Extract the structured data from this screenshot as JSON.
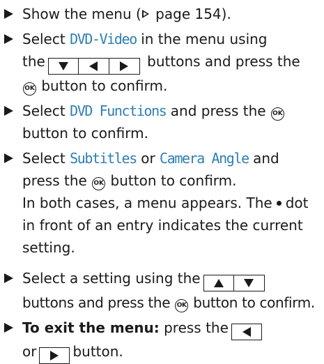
{
  "steps": [
    {
      "a": "Show the menu (",
      "ref": "page 154",
      "b": ")."
    },
    {
      "a": "Select ",
      "hl": "DVD-Video",
      "b": " in the menu using",
      "c": "the",
      "d": " buttons and press the",
      "e": " button to confirm."
    },
    {
      "a": "Select ",
      "hl": "DVD Functions",
      "b": " and press the",
      "c": "button to confirm."
    },
    {
      "a": "Select ",
      "hl1": "Subtitles",
      "or": " or ",
      "hl2": "Camera Angle",
      "b": " and",
      "c": "press the",
      "d": " button to confirm.",
      "e": "In both cases, a menu appears. The",
      "f": "dot",
      "g": "in front of an entry indicates the current",
      "h": "setting."
    },
    {
      "a": "Select a setting using the",
      "b": "buttons and press the",
      "c": "button to confirm."
    },
    {
      "bold": "To exit the menu:",
      "a": " press the",
      "b": "or",
      "c": "button."
    }
  ],
  "icons": {
    "bullet": "triangle-right-bullet-icon",
    "page_ref": "triangle-page-reference-icon",
    "ok": "ok-button-icon",
    "ok_label": "OK",
    "down": "down-arrow-key-icon",
    "up": "up-arrow-key-icon",
    "left": "left-arrow-key-icon",
    "right": "right-arrow-key-icon",
    "dot": "selection-dot-icon"
  },
  "colors": {
    "highlight": "#2f7fb3",
    "text": "#1a1a1a"
  }
}
